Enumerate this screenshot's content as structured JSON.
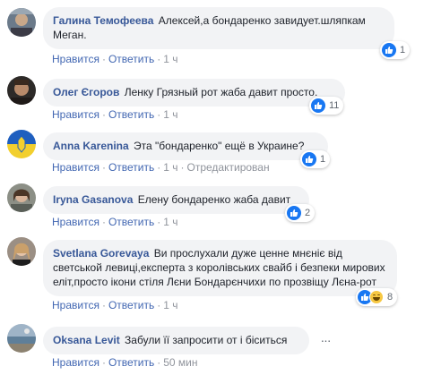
{
  "actions": {
    "like": "Нравится",
    "reply": "Ответить",
    "sep": "·",
    "edited": "Отредактирован"
  },
  "colors": {
    "author": "#385898",
    "link": "#4267b2",
    "bubble": "#f2f3f5",
    "like_blue": "#1877f2"
  },
  "comments": [
    {
      "author": "Галина Темофеева",
      "text": "Алексей,а бондаренко завидует.шляпкам",
      "text2": "Меган.",
      "time": "1 ч",
      "reactions": [
        "like-icon"
      ],
      "count": "1"
    },
    {
      "author": "Олег Єгоров",
      "text": "Ленку Грязный рот жаба давит просто.",
      "time": "1 ч",
      "reactions": [
        "like-icon"
      ],
      "count": "11"
    },
    {
      "author": "Anna Karenina",
      "text": "Эта \"бондаренко\" ещё в Украине?",
      "time": "1 ч",
      "edited": true,
      "reactions": [
        "like-icon"
      ],
      "count": "1"
    },
    {
      "author": "Iryna Gasanova",
      "text": "Елену бондаренко жаба давит",
      "time": "1 ч",
      "reactions": [
        "like-icon"
      ],
      "count": "2"
    },
    {
      "author": "Svetlana Gorevaya",
      "text": "Ви прослухали дуже ценне мнєніє від",
      "text2": "светськой левиці,експерта з королівських свайб і безпеки мирових",
      "text3": "еліт,просто ікони стіля Лєни Бондарєнчихи по прозвіщу Лєна-рот",
      "time": "1 ч",
      "reactions": [
        "like-icon",
        "laugh-icon"
      ],
      "count": "8"
    },
    {
      "author": "Oksana Levit",
      "text": "Забули її запросити от і біситься",
      "time": "50 мин"
    }
  ]
}
